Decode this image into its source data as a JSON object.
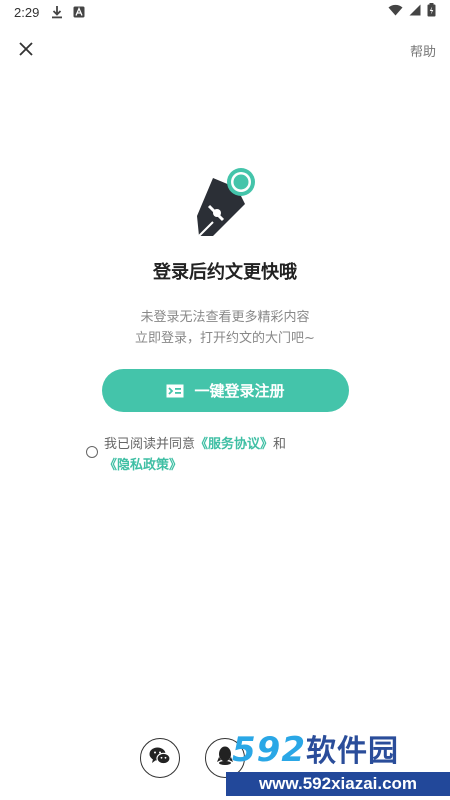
{
  "status_bar": {
    "time": "2:29",
    "icons": [
      "download-icon",
      "a-icon",
      "wifi-icon",
      "signal-icon",
      "battery-icon"
    ]
  },
  "header": {
    "close_icon": "close-icon",
    "help_label": "帮助"
  },
  "main": {
    "logo_icon": "pen-nib-logo",
    "title": "登录后约文更快哦",
    "subtitle_line1": "未登录无法查看更多精彩内容",
    "subtitle_line2": "立即登录，打开约文的大门吧~",
    "login_button_label": "一键登录注册"
  },
  "agreement": {
    "prefix": "我已阅读并同意",
    "service_link": "《服务协议》",
    "connector": "和",
    "privacy_link": "《隐私政策》",
    "checked": false
  },
  "social": [
    "wechat-icon",
    "qq-icon"
  ],
  "watermark": {
    "number": "592",
    "name": "软件园",
    "url": "www.592xiazai.com"
  },
  "colors": {
    "accent": "#44c4aa",
    "link": "#3fbfa4",
    "logo_dark": "#2b2f36"
  }
}
